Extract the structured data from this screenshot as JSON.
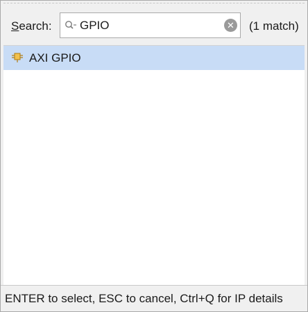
{
  "search": {
    "label_mnemonic": "S",
    "label_rest": "earch:",
    "value": "GPIO",
    "match_count": "(1 match)",
    "icons": {
      "search": "search-filter-icon",
      "clear": "clear-icon"
    }
  },
  "results": [
    {
      "label": "AXI GPIO",
      "icon": "ip-block-icon",
      "selected": true
    }
  ],
  "footer": {
    "hint": "ENTER to select, ESC to cancel, Ctrl+Q for IP details"
  },
  "colors": {
    "selection": "#c8dcf6",
    "ip_icon": "#e0a830",
    "panel": "#f0f0f0"
  }
}
